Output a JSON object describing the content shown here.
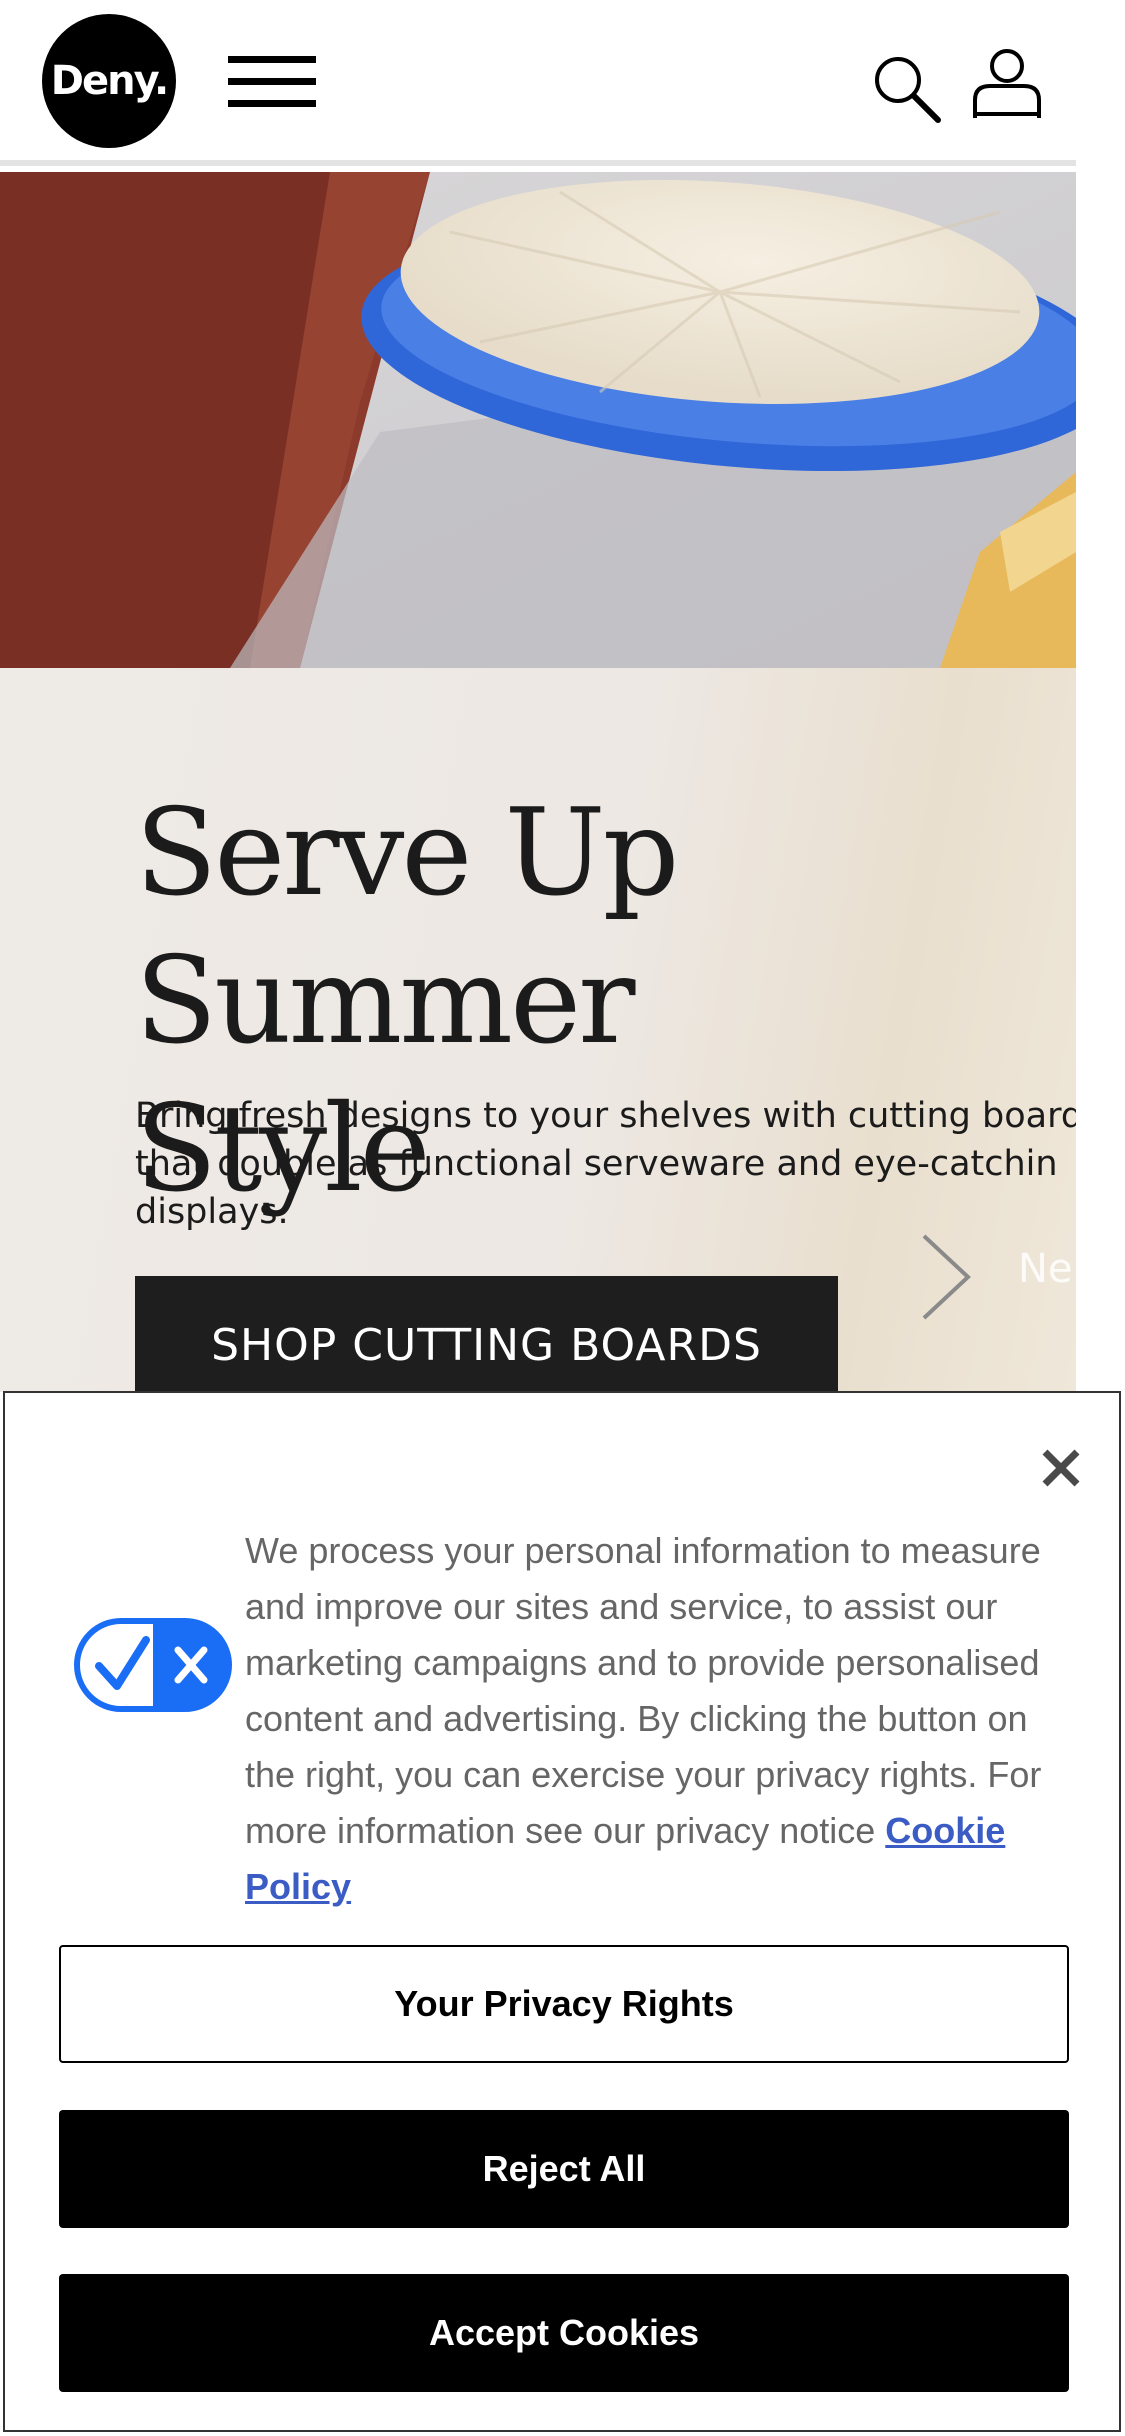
{
  "header": {
    "logo_text": "Deny.",
    "icons": [
      "menu-icon",
      "search-icon",
      "account-icon"
    ]
  },
  "hero": {
    "title_line1": "Serve Up",
    "title_line2": "Summer Style",
    "subtitle": "Bring fresh designs to your shelves with cutting board\nthat double as functional serveware and eye-catchin\ndisplays.",
    "cta_label": "SHOP CUTTING BOARDS",
    "next_label": "Ne"
  },
  "cookie": {
    "text": "We process your personal information to measure and improve our sites and service, to assist our marketing campaigns and to provide personalised content and advertising. By clicking the button on the right, you can exercise your privacy rights. For more information see our privacy notice ",
    "link_label": "Cookie Policy",
    "privacy_rights_label": "Your Privacy Rights",
    "reject_label": "Reject All",
    "accept_label": "Accept Cookies",
    "badge_color": "#1a6ef5"
  }
}
